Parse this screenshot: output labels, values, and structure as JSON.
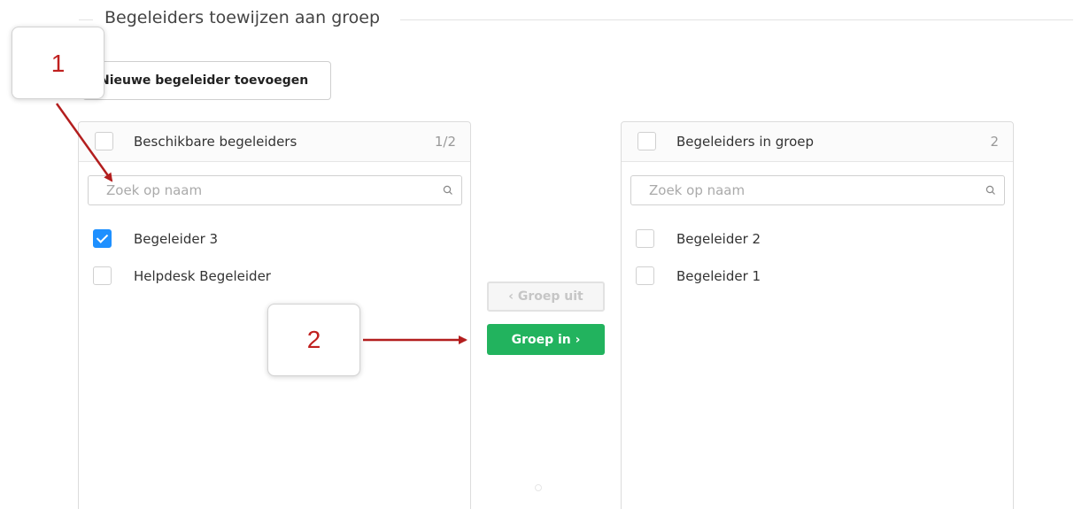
{
  "section": {
    "legend": "Begeleiders toewijzen aan groep",
    "add_button": "Nieuwe begeleider toevoegen"
  },
  "left_panel": {
    "title": "Beschikbare begeleiders",
    "count": "1/2",
    "search_placeholder": "Zoek op naam",
    "items": [
      {
        "label": "Begeleider 3",
        "checked": true
      },
      {
        "label": "Helpdesk Begeleider",
        "checked": false
      }
    ]
  },
  "right_panel": {
    "title": "Begeleiders in groep",
    "count": "2",
    "search_placeholder": "Zoek op naam",
    "items": [
      {
        "label": "Begeleider 2",
        "checked": false
      },
      {
        "label": "Begeleider 1",
        "checked": false
      }
    ]
  },
  "transfer": {
    "out_label": "‹ Groep uit",
    "in_label": "Groep in ›"
  },
  "annotations": {
    "callout_1": "1",
    "callout_2": "2"
  },
  "colors": {
    "accent_green": "#22b35e",
    "checkbox_blue": "#1e90ff",
    "annotation_red": "#c0201f"
  },
  "icons": [
    "search-icon",
    "checkmark-icon",
    "arrow-icon"
  ]
}
